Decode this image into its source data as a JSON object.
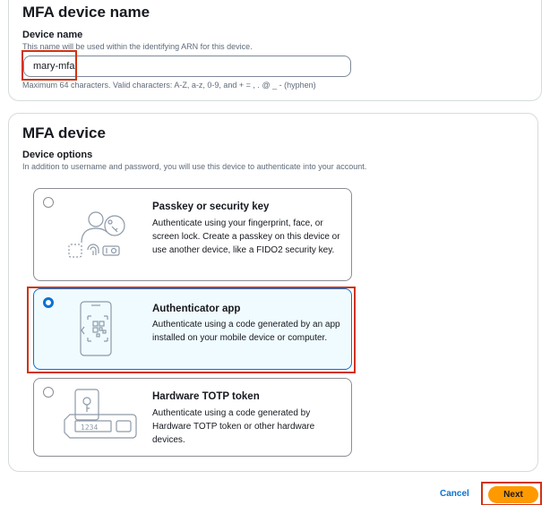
{
  "mfa_device_name_section": {
    "title": "MFA device name",
    "field_label": "Device name",
    "field_description": "This name will be used within the identifying ARN for this device.",
    "device_name_value": "mary-mfa",
    "constraint": "Maximum 64 characters. Valid characters: A-Z, a-z, 0-9, and + = , . @ _ - (hyphen)"
  },
  "mfa_device_section": {
    "title": "MFA device",
    "field_label": "Device options",
    "field_description": "In addition to username and password, you will use this device to authenticate into your account.",
    "selected_option": "Authenticator app",
    "options": [
      {
        "title": "Passkey or security key",
        "description": "Authenticate using your fingerprint, face, or screen lock. Create a passkey on this device or use another device, like a FIDO2 security key.",
        "icon": "passkey-illustration-icon"
      },
      {
        "title": "Authenticator app",
        "description": "Authenticate using a code generated by an app installed on your mobile device or computer.",
        "icon": "authenticator-app-illustration-icon"
      },
      {
        "title": "Hardware TOTP token",
        "description": "Authenticate using a code generated by Hardware TOTP token or other hardware devices.",
        "icon": "hardware-token-illustration-icon",
        "token_display": "1234"
      }
    ]
  },
  "footer": {
    "cancel_label": "Cancel",
    "next_label": "Next"
  },
  "colors": {
    "accent": "#0972d3",
    "primary_button": "#ff9900",
    "highlight_box": "#d13212"
  }
}
